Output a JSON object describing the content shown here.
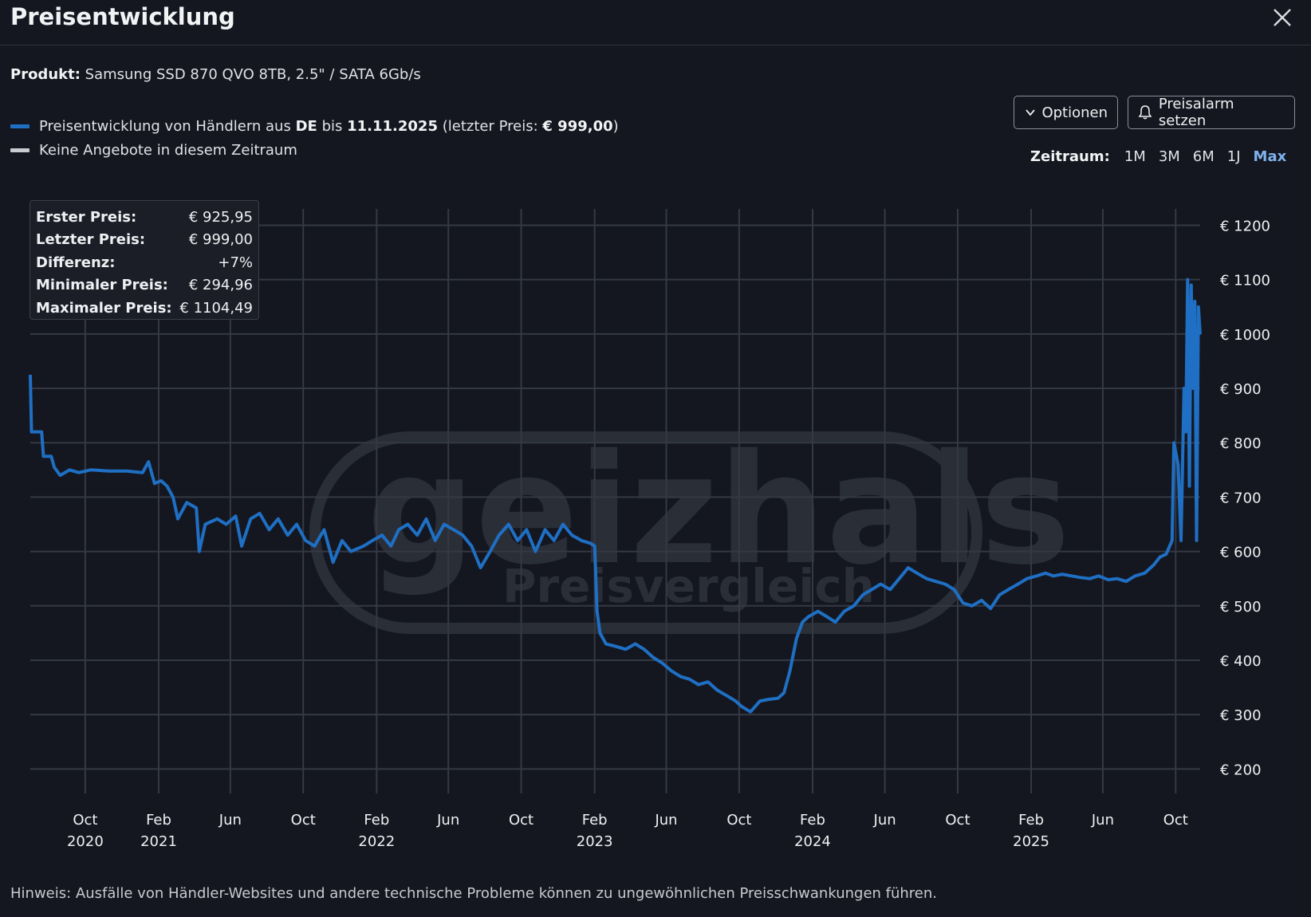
{
  "dialog": {
    "title": "Preisentwicklung",
    "close_label": "close"
  },
  "product": {
    "label": "Produkt:",
    "name": "Samsung SSD 870 QVO 8TB, 2.5\" / SATA 6Gb/s"
  },
  "legend": {
    "series_prefix": "Preisentwicklung von Händlern aus",
    "country": "DE",
    "until": "bis",
    "date": "11.11.2025",
    "last_price_prefix": "(letzter Preis:",
    "last_price": "€ 999,00",
    "last_price_suffix": ")",
    "no_offers": "Keine Angebote in diesem Zeitraum",
    "series_color": "#1f6fc4",
    "no_offers_color": "#c9cbd0"
  },
  "buttons": {
    "options": "Optionen",
    "alarm": "Preisalarm setzen"
  },
  "range": {
    "label": "Zeitraum:",
    "options": [
      "1M",
      "3M",
      "6M",
      "1J",
      "Max"
    ],
    "active": "Max"
  },
  "stats": {
    "first_label": "Erster Preis:",
    "first": "€ 925,95",
    "last_label": "Letzter Preis:",
    "last": "€ 999,00",
    "diff_label": "Differenz:",
    "diff": "+7%",
    "min_label": "Minimaler Preis:",
    "min": "€ 294,96",
    "max_label": "Maximaler Preis:",
    "max": "€ 1104,49"
  },
  "watermark": "geizhals Preisvergleich",
  "hint": "Hinweis: Ausfälle von Händler-Websites und andere technische Probleme können zu ungewöhnlichen Preisschwankungen führen.",
  "chart_data": {
    "type": "line",
    "xlabel": "",
    "ylabel": "",
    "x_ticks": [
      {
        "date": "2020-10",
        "label": "Oct",
        "year": "2020"
      },
      {
        "date": "2021-02",
        "label": "Feb",
        "year": "2021"
      },
      {
        "date": "2021-06",
        "label": "Jun",
        "year": ""
      },
      {
        "date": "2021-10",
        "label": "Oct",
        "year": ""
      },
      {
        "date": "2022-02",
        "label": "Feb",
        "year": "2022"
      },
      {
        "date": "2022-06",
        "label": "Jun",
        "year": ""
      },
      {
        "date": "2022-10",
        "label": "Oct",
        "year": ""
      },
      {
        "date": "2023-02",
        "label": "Feb",
        "year": "2023"
      },
      {
        "date": "2023-06",
        "label": "Jun",
        "year": ""
      },
      {
        "date": "2023-10",
        "label": "Oct",
        "year": ""
      },
      {
        "date": "2024-02",
        "label": "Feb",
        "year": "2024"
      },
      {
        "date": "2024-06",
        "label": "Jun",
        "year": ""
      },
      {
        "date": "2024-10",
        "label": "Oct",
        "year": ""
      },
      {
        "date": "2025-02",
        "label": "Feb",
        "year": "2025"
      },
      {
        "date": "2025-06",
        "label": "Jun",
        "year": ""
      },
      {
        "date": "2025-10",
        "label": "Oct",
        "year": ""
      }
    ],
    "xlim": [
      "2020-07-01",
      "2025-11-11"
    ],
    "y_ticks": [
      200,
      300,
      400,
      500,
      600,
      700,
      800,
      900,
      1000,
      1100,
      1200
    ],
    "y_tick_labels": [
      "€ 200",
      "€ 300",
      "€ 400",
      "€ 500",
      "€ 600",
      "€ 700",
      "€ 800",
      "€ 900",
      "€ 1000",
      "€ 1100",
      "€ 1200"
    ],
    "ylim": [
      155,
      1230
    ],
    "grid": true,
    "series": [
      {
        "color": "#1f6fc4",
        "points": [
          [
            "2020-07-01",
            925
          ],
          [
            "2020-07-03",
            820
          ],
          [
            "2020-07-20",
            820
          ],
          [
            "2020-07-23",
            775
          ],
          [
            "2020-08-05",
            775
          ],
          [
            "2020-08-10",
            755
          ],
          [
            "2020-08-20",
            740
          ],
          [
            "2020-09-05",
            750
          ],
          [
            "2020-09-20",
            745
          ],
          [
            "2020-10-10",
            750
          ],
          [
            "2020-11-10",
            748
          ],
          [
            "2020-12-10",
            748
          ],
          [
            "2021-01-05",
            745
          ],
          [
            "2021-01-15",
            765
          ],
          [
            "2021-01-25",
            725
          ],
          [
            "2021-02-05",
            730
          ],
          [
            "2021-02-15",
            720
          ],
          [
            "2021-02-25",
            700
          ],
          [
            "2021-03-05",
            660
          ],
          [
            "2021-03-20",
            690
          ],
          [
            "2021-04-05",
            680
          ],
          [
            "2021-04-10",
            600
          ],
          [
            "2021-04-20",
            650
          ],
          [
            "2021-05-10",
            660
          ],
          [
            "2021-05-25",
            650
          ],
          [
            "2021-06-10",
            665
          ],
          [
            "2021-06-20",
            610
          ],
          [
            "2021-07-05",
            660
          ],
          [
            "2021-07-20",
            670
          ],
          [
            "2021-08-05",
            640
          ],
          [
            "2021-08-20",
            660
          ],
          [
            "2021-09-05",
            630
          ],
          [
            "2021-09-20",
            650
          ],
          [
            "2021-10-05",
            620
          ],
          [
            "2021-10-20",
            610
          ],
          [
            "2021-11-05",
            640
          ],
          [
            "2021-11-20",
            580
          ],
          [
            "2021-12-05",
            620
          ],
          [
            "2021-12-20",
            600
          ],
          [
            "2022-01-10",
            610
          ],
          [
            "2022-01-25",
            620
          ],
          [
            "2022-02-10",
            630
          ],
          [
            "2022-02-25",
            610
          ],
          [
            "2022-03-10",
            640
          ],
          [
            "2022-03-25",
            650
          ],
          [
            "2022-04-10",
            630
          ],
          [
            "2022-04-25",
            660
          ],
          [
            "2022-05-10",
            620
          ],
          [
            "2022-05-25",
            650
          ],
          [
            "2022-06-10",
            640
          ],
          [
            "2022-06-25",
            630
          ],
          [
            "2022-07-10",
            610
          ],
          [
            "2022-07-25",
            570
          ],
          [
            "2022-08-10",
            600
          ],
          [
            "2022-08-25",
            630
          ],
          [
            "2022-09-10",
            650
          ],
          [
            "2022-09-25",
            620
          ],
          [
            "2022-10-10",
            640
          ],
          [
            "2022-10-25",
            600
          ],
          [
            "2022-11-10",
            640
          ],
          [
            "2022-11-25",
            620
          ],
          [
            "2022-12-10",
            650
          ],
          [
            "2022-12-25",
            630
          ],
          [
            "2023-01-10",
            620
          ],
          [
            "2023-01-25",
            615
          ],
          [
            "2023-02-01",
            610
          ],
          [
            "2023-02-05",
            490
          ],
          [
            "2023-02-10",
            450
          ],
          [
            "2023-02-20",
            430
          ],
          [
            "2023-03-10",
            425
          ],
          [
            "2023-03-25",
            420
          ],
          [
            "2023-04-10",
            430
          ],
          [
            "2023-04-25",
            420
          ],
          [
            "2023-05-10",
            405
          ],
          [
            "2023-05-25",
            395
          ],
          [
            "2023-06-10",
            380
          ],
          [
            "2023-06-25",
            370
          ],
          [
            "2023-07-10",
            365
          ],
          [
            "2023-07-25",
            355
          ],
          [
            "2023-08-10",
            360
          ],
          [
            "2023-08-25",
            345
          ],
          [
            "2023-09-10",
            335
          ],
          [
            "2023-09-25",
            325
          ],
          [
            "2023-10-05",
            315
          ],
          [
            "2023-10-20",
            305
          ],
          [
            "2023-11-05",
            325
          ],
          [
            "2023-11-20",
            328
          ],
          [
            "2023-12-05",
            330
          ],
          [
            "2023-12-15",
            340
          ],
          [
            "2023-12-25",
            380
          ],
          [
            "2024-01-05",
            440
          ],
          [
            "2024-01-15",
            470
          ],
          [
            "2024-01-25",
            480
          ],
          [
            "2024-02-10",
            490
          ],
          [
            "2024-02-25",
            480
          ],
          [
            "2024-03-10",
            470
          ],
          [
            "2024-03-25",
            490
          ],
          [
            "2024-04-10",
            500
          ],
          [
            "2024-04-25",
            520
          ],
          [
            "2024-05-10",
            530
          ],
          [
            "2024-05-25",
            540
          ],
          [
            "2024-06-10",
            530
          ],
          [
            "2024-06-25",
            550
          ],
          [
            "2024-07-10",
            570
          ],
          [
            "2024-07-25",
            560
          ],
          [
            "2024-08-10",
            550
          ],
          [
            "2024-08-25",
            545
          ],
          [
            "2024-09-10",
            540
          ],
          [
            "2024-09-25",
            530
          ],
          [
            "2024-10-10",
            505
          ],
          [
            "2024-10-25",
            500
          ],
          [
            "2024-11-10",
            510
          ],
          [
            "2024-11-25",
            495
          ],
          [
            "2024-12-10",
            520
          ],
          [
            "2024-12-25",
            530
          ],
          [
            "2025-01-10",
            540
          ],
          [
            "2025-01-25",
            550
          ],
          [
            "2025-02-10",
            555
          ],
          [
            "2025-02-25",
            560
          ],
          [
            "2025-03-10",
            555
          ],
          [
            "2025-03-25",
            558
          ],
          [
            "2025-04-10",
            555
          ],
          [
            "2025-04-25",
            552
          ],
          [
            "2025-05-10",
            550
          ],
          [
            "2025-05-25",
            555
          ],
          [
            "2025-06-10",
            548
          ],
          [
            "2025-06-25",
            550
          ],
          [
            "2025-07-10",
            545
          ],
          [
            "2025-07-25",
            555
          ],
          [
            "2025-08-10",
            560
          ],
          [
            "2025-08-25",
            575
          ],
          [
            "2025-09-05",
            590
          ],
          [
            "2025-09-15",
            595
          ],
          [
            "2025-09-25",
            620
          ],
          [
            "2025-09-28",
            800
          ],
          [
            "2025-10-05",
            760
          ],
          [
            "2025-10-10",
            620
          ],
          [
            "2025-10-15",
            900
          ],
          [
            "2025-10-18",
            820
          ],
          [
            "2025-10-21",
            1100
          ],
          [
            "2025-10-24",
            720
          ],
          [
            "2025-10-27",
            1090
          ],
          [
            "2025-10-30",
            900
          ],
          [
            "2025-11-02",
            1060
          ],
          [
            "2025-11-05",
            620
          ],
          [
            "2025-11-08",
            1050
          ],
          [
            "2025-11-11",
            999
          ]
        ]
      }
    ]
  }
}
